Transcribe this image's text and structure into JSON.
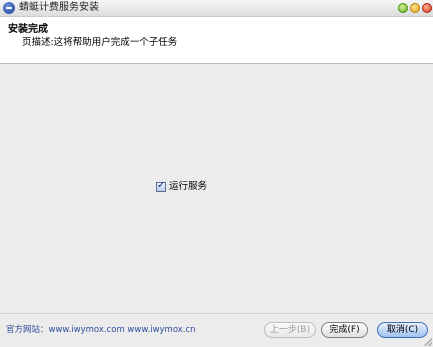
{
  "window": {
    "title": "蜻蜓计费服务安装"
  },
  "header": {
    "title": "安装完成",
    "description": "页描述:这将帮助用户完成一个子任务"
  },
  "options": {
    "run_service_label": "运行服务",
    "run_service_checked": true
  },
  "footer": {
    "website_text": "官方网站：www.iwymox.com www.iwymox.cn",
    "prev_label": "上一步(B)",
    "finish_label": "完成(F)",
    "cancel_label": "取消(C)"
  },
  "icons": [
    "app-logo-icon",
    "minimize-icon",
    "maximize-icon",
    "close-icon",
    "checkbox-check-icon",
    "resize-grip-icon"
  ]
}
